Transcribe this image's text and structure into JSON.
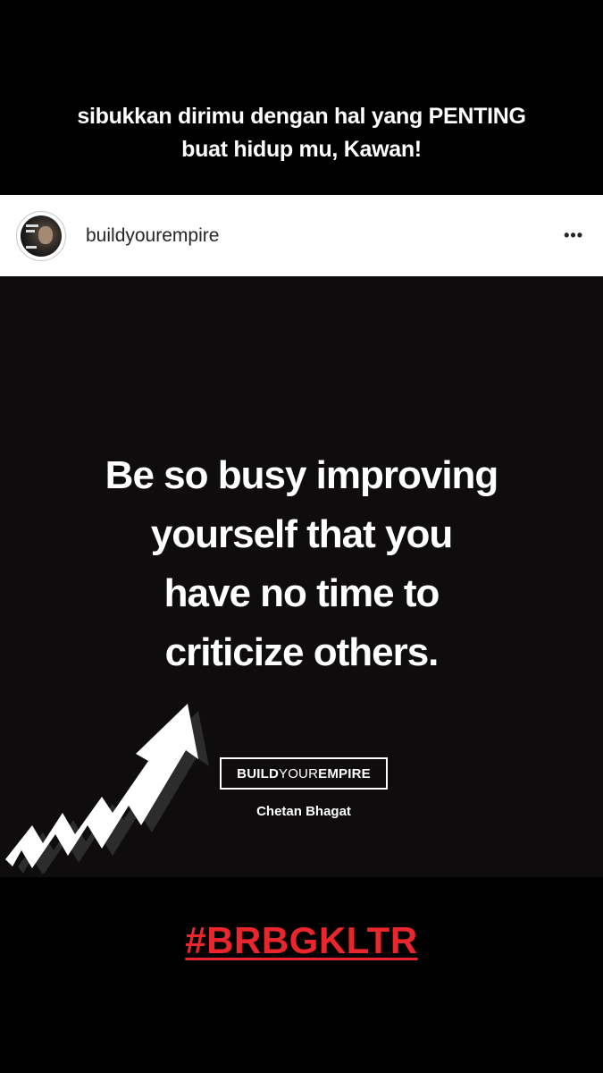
{
  "story_caption": {
    "line1": "sibukkan dirimu dengan hal yang PENTING",
    "line2": "buat hidup mu, Kawan!"
  },
  "post_header": {
    "username": "buildyourempire",
    "more_icon": "more-options-icon",
    "more_glyph": "•••"
  },
  "post": {
    "quote_lines": [
      "Be so busy improving",
      "yourself that you",
      "have no time to",
      "criticize others."
    ],
    "brand_bold_1": "BUILD",
    "brand_light": "YOUR",
    "brand_bold_2": "EMPIRE",
    "author": "Chetan Bhagat",
    "graphic_icon": "rising-zigzag-arrow-icon"
  },
  "hashtag": "#BRBGKLTR",
  "colors": {
    "background": "#000000",
    "post_background": "#0e0c0c",
    "header_background": "#ffffff",
    "hashtag_red": "#e8262b",
    "text": "#ffffff"
  }
}
